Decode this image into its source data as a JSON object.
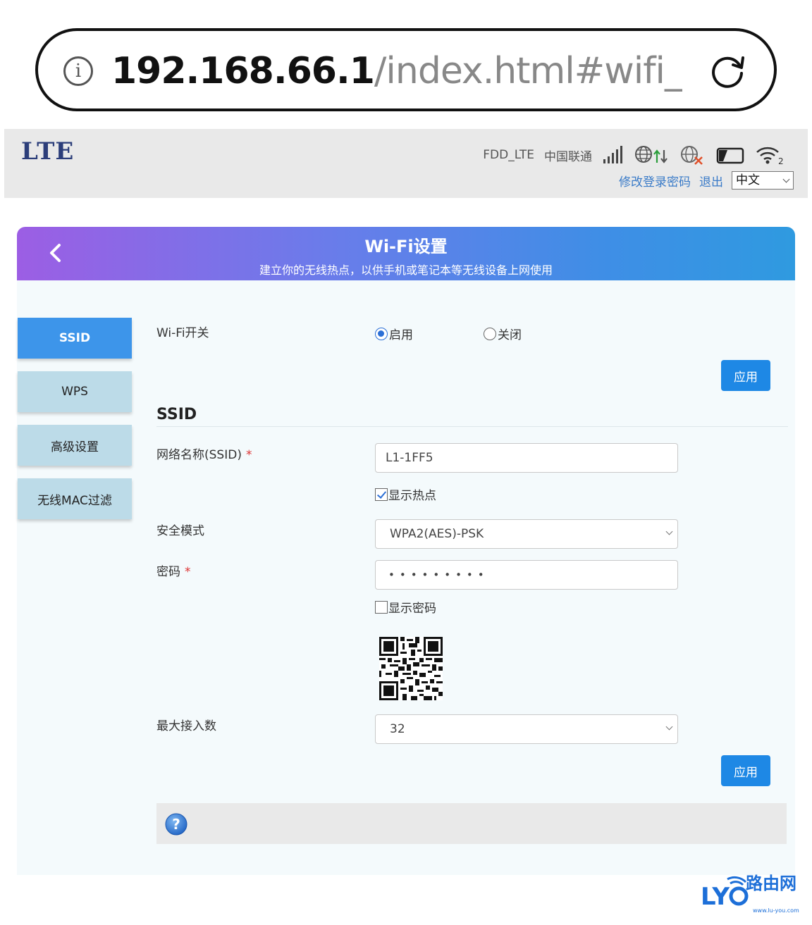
{
  "browser": {
    "url_host": "192.168.66.1",
    "url_path": "/index.html#wifi_ma"
  },
  "header": {
    "logo": "LTE",
    "network_type": "FDD_LTE",
    "carrier": "中国联通",
    "change_password": "修改登录密码",
    "logout": "退出",
    "language": "中文"
  },
  "banner": {
    "title": "Wi-Fi设置",
    "subtitle": "建立你的无线热点，以供手机或笔记本等无线设备上网使用"
  },
  "sidebar": {
    "items": [
      {
        "label": "SSID"
      },
      {
        "label": "WPS"
      },
      {
        "label": "高级设置"
      },
      {
        "label": "无线MAC过滤"
      }
    ]
  },
  "wifi_switch": {
    "label": "Wi-Fi开关",
    "on_label": "启用",
    "off_label": "关闭",
    "apply": "应用"
  },
  "ssid_section": {
    "title": "SSID",
    "name_label": "网络名称(SSID)",
    "required_mark": "*",
    "name_value": "L1-1FF5",
    "broadcast_label": "显示热点",
    "security_label": "安全模式",
    "security_value": "WPA2(AES)-PSK",
    "password_label": "密码",
    "password_value": "•••••••••",
    "show_password_label": "显示密码",
    "max_clients_label": "最大接入数",
    "max_clients_value": "32",
    "apply": "应用"
  },
  "watermark": {
    "text": "路由网",
    "url": "www.lu-you.com"
  },
  "colors": {
    "accent": "#1e88e5",
    "active_tab": "#3d95ea",
    "tab": "#bcdbe8",
    "banner_start": "#9c5ee4",
    "banner_end": "#2f9ae0",
    "required": "#dd3333"
  }
}
